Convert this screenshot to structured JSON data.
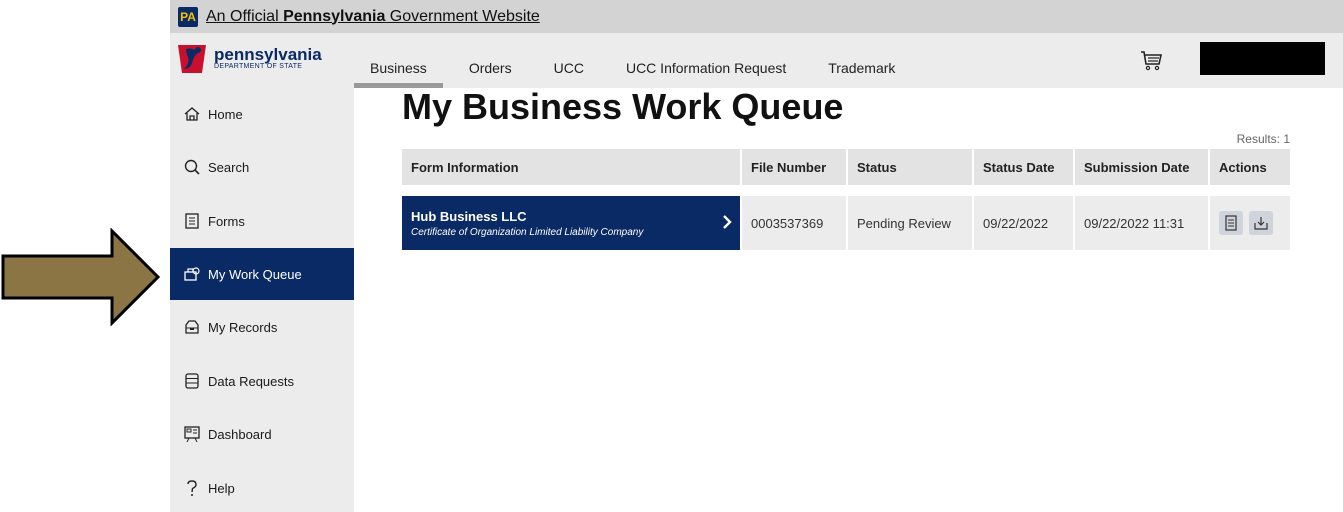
{
  "banner": {
    "badge": "PA",
    "prefix": "An Official ",
    "state": "Pennsylvania",
    "suffix": " Government Website"
  },
  "logo": {
    "name": "pennsylvania",
    "subtitle": "DEPARTMENT OF STATE"
  },
  "topnav": [
    {
      "label": "Business",
      "active": true
    },
    {
      "label": "Orders",
      "active": false
    },
    {
      "label": "UCC",
      "active": false
    },
    {
      "label": "UCC Information Request",
      "active": false
    },
    {
      "label": "Trademark",
      "active": false
    }
  ],
  "header_icons": {
    "cart": "cart-icon"
  },
  "sidebar": {
    "items": [
      {
        "label": "Home",
        "icon": "home-icon"
      },
      {
        "label": "Search",
        "icon": "search-icon"
      },
      {
        "label": "Forms",
        "icon": "forms-icon"
      },
      {
        "label": "My Work Queue",
        "icon": "work-queue-icon",
        "active": true
      },
      {
        "label": "My Records",
        "icon": "records-icon"
      },
      {
        "label": "Data Requests",
        "icon": "database-icon"
      },
      {
        "label": "Dashboard",
        "icon": "dashboard-icon"
      },
      {
        "label": "Help",
        "icon": "help-icon"
      }
    ]
  },
  "main": {
    "title": "My Business Work Queue",
    "results": "Results: 1",
    "columns": [
      "Form Information",
      "File Number",
      "Status",
      "Status Date",
      "Submission Date",
      "Actions"
    ],
    "rows": [
      {
        "form_name": "Hub Business LLC",
        "form_type": "Certificate of Organization  Limited Liability Company",
        "file_number": "0003537369",
        "status": "Pending Review",
        "status_date": "09/22/2022",
        "submission_date": "09/22/2022 11:31",
        "actions": [
          "view-document-icon",
          "download-icon"
        ]
      }
    ]
  },
  "colors": {
    "navy": "#0a2a66",
    "arrow": "#8b7544",
    "sidebar_bg": "#ececec",
    "header_bg": "#ececec",
    "banner_bg": "#d3d3d3"
  }
}
